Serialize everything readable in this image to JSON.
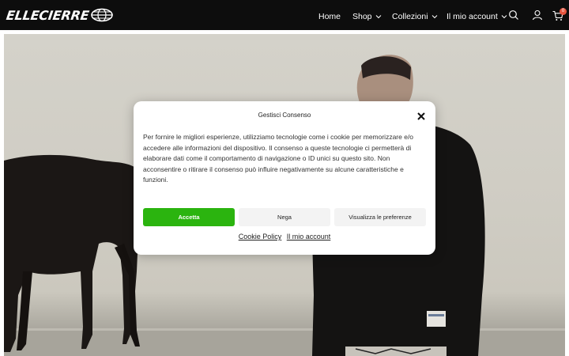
{
  "header": {
    "logo_text": "ELLECIERRE",
    "nav": [
      {
        "label": "Home"
      },
      {
        "label": "Shop"
      },
      {
        "label": "Collezioni"
      },
      {
        "label": "Il mio account"
      }
    ],
    "cart_count": "0"
  },
  "hero": {
    "alt_icons": [
      "horse",
      "person"
    ]
  },
  "consent_modal": {
    "title": "Gestisci Consenso",
    "body": "Per fornire le migliori esperienze, utilizziamo tecnologie come i cookie per memorizzare e/o accedere alle informazioni del dispositivo. Il consenso a queste tecnologie ci permetterà di elaborare dati come il comportamento di navigazione o ID unici su questo sito. Non acconsentire o ritirare il consenso può influire negativamente su alcune caratteristiche e funzioni.",
    "accept_label": "Accetta",
    "deny_label": "Nega",
    "prefs_label": "Visualizza le preferenze",
    "links": [
      "Cookie Policy",
      "Il mio account"
    ]
  },
  "colors": {
    "header_bg": "#0d0d0d",
    "accept": "#2bb40f",
    "cart_badge": "#e8553f"
  }
}
